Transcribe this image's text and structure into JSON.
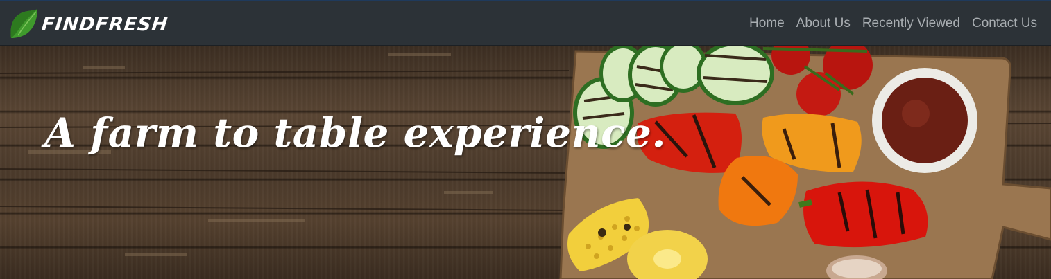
{
  "brand": {
    "name": "FindFresh",
    "leaf_color": "#3f9a2c"
  },
  "nav": {
    "items": [
      {
        "label": "Home"
      },
      {
        "label": "About Us"
      },
      {
        "label": "Recently Viewed"
      },
      {
        "label": "Contact Us"
      }
    ]
  },
  "hero": {
    "heading": "A farm to table experience.",
    "image_description_icons": [
      "cutting-board",
      "zucchini-slice",
      "bell-pepper",
      "corn-cob",
      "cherry-tomato",
      "sauce-bowl",
      "mushroom"
    ]
  },
  "colors": {
    "navbar_bg": "#2c3237",
    "nav_link": "#a9aeb2",
    "heading": "#ffffff"
  }
}
